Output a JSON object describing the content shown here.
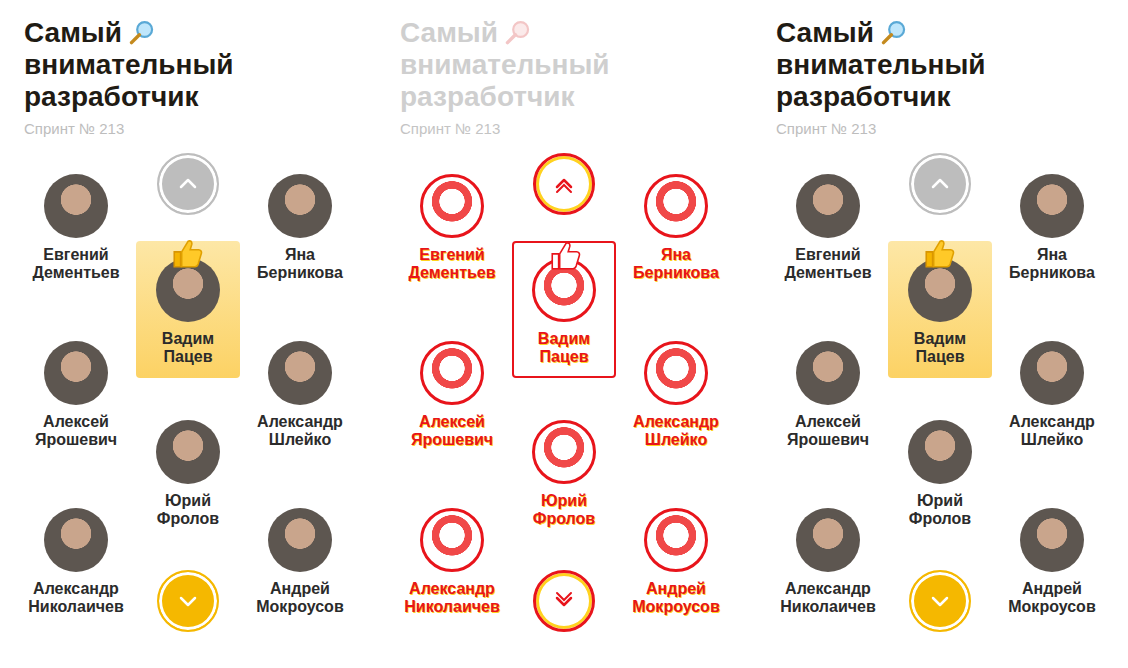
{
  "panels": [
    {
      "kind": "normal"
    },
    {
      "kind": "diff"
    },
    {
      "kind": "normal"
    }
  ],
  "card": {
    "title": [
      "Самый",
      "внимательный",
      "разработчик"
    ],
    "subtitle": "Спринт № 213",
    "left": [
      {
        "first": "Евгений",
        "last": "Дементьев",
        "selected": false
      },
      {
        "first": "Алексей",
        "last": "Ярошевич",
        "selected": false
      },
      {
        "first": "Александр",
        "last": "Николаичев",
        "selected": false
      }
    ],
    "center": [
      {
        "first": "Вадим",
        "last": "Пацев",
        "selected": true
      },
      {
        "first": "Юрий",
        "last": "Фролов",
        "selected": false
      }
    ],
    "right": [
      {
        "first": "Яна",
        "last": "Берникова",
        "selected": false
      },
      {
        "first": "Александр",
        "last": "Шлейко",
        "selected": false
      },
      {
        "first": "Андрей",
        "last": "Мокроусов",
        "selected": false
      }
    ],
    "scroll_up": {
      "disabled": true
    },
    "scroll_down": {
      "disabled": false
    }
  }
}
